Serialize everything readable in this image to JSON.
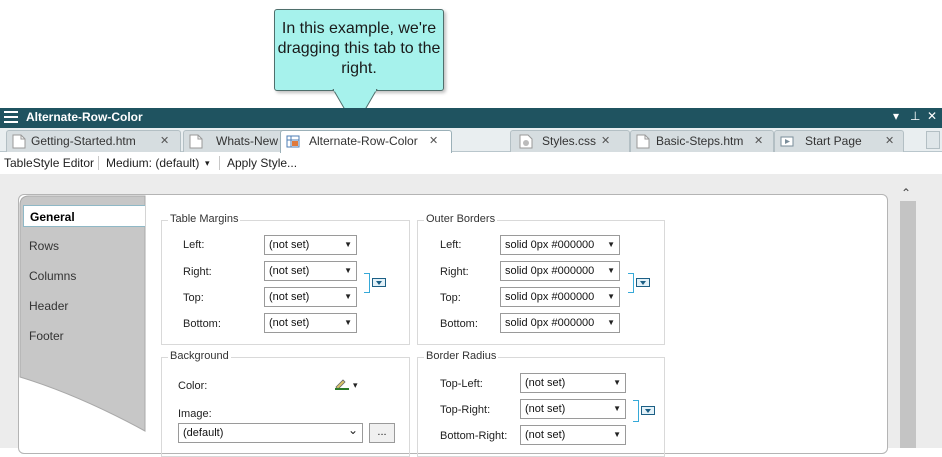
{
  "callout": {
    "text": "In this example, we're dragging this tab to the right."
  },
  "window": {
    "title": "Alternate-Row-Color",
    "menu_icon": "hamburger-icon",
    "dropdown_glyph": "▾",
    "pin_glyph": "⊥",
    "close_glyph": "✕"
  },
  "tabs": [
    {
      "label": "Getting-Started.htm",
      "close": "✕"
    },
    {
      "label": "Whats-New",
      "close": ""
    },
    {
      "label": "Alternate-Row-Color",
      "close": "✕"
    },
    {
      "label": "Styles.css",
      "close": "✕"
    },
    {
      "label": "Basic-Steps.htm",
      "close": "✕"
    },
    {
      "label": "Start Page",
      "close": "✕"
    }
  ],
  "toolbar": {
    "editor_label": "TableStyle Editor",
    "medium_label": "Medium: (default)",
    "medium_arrow": "▾",
    "apply_label": "Apply Style..."
  },
  "sidebar": {
    "items": [
      {
        "label": "General"
      },
      {
        "label": "Rows"
      },
      {
        "label": "Columns"
      },
      {
        "label": "Header"
      },
      {
        "label": "Footer"
      }
    ]
  },
  "table_margins": {
    "title": "Table Margins",
    "rows": [
      {
        "label": "Left:",
        "value": "(not set)"
      },
      {
        "label": "Right:",
        "value": "(not set)"
      },
      {
        "label": "Top:",
        "value": "(not set)"
      },
      {
        "label": "Bottom:",
        "value": "(not set)"
      }
    ]
  },
  "outer_borders": {
    "title": "Outer Borders",
    "rows": [
      {
        "label": "Left:",
        "value": "solid 0px #000000"
      },
      {
        "label": "Right:",
        "value": "solid 0px #000000"
      },
      {
        "label": "Top:",
        "value": "solid 0px #000000"
      },
      {
        "label": "Bottom:",
        "value": "solid 0px #000000"
      }
    ]
  },
  "background": {
    "title": "Background",
    "color_label": "Color:",
    "image_label": "Image:",
    "image_value": "(default)",
    "browse_label": "...",
    "dropdown_glyph": "▾",
    "chevron_glyph": "⌄"
  },
  "border_radius": {
    "title": "Border Radius",
    "rows": [
      {
        "label": "Top-Left:",
        "value": "(not set)"
      },
      {
        "label": "Top-Right:",
        "value": "(not set)"
      },
      {
        "label": "Bottom-Right:",
        "value": "(not set)"
      }
    ]
  },
  "dropdown_arrow": "▼",
  "scroll_up_glyph": "⌃",
  "colors": {
    "titlebar": "#1f5360",
    "callout": "#a6f2ec",
    "accent": "#36a9d8"
  }
}
